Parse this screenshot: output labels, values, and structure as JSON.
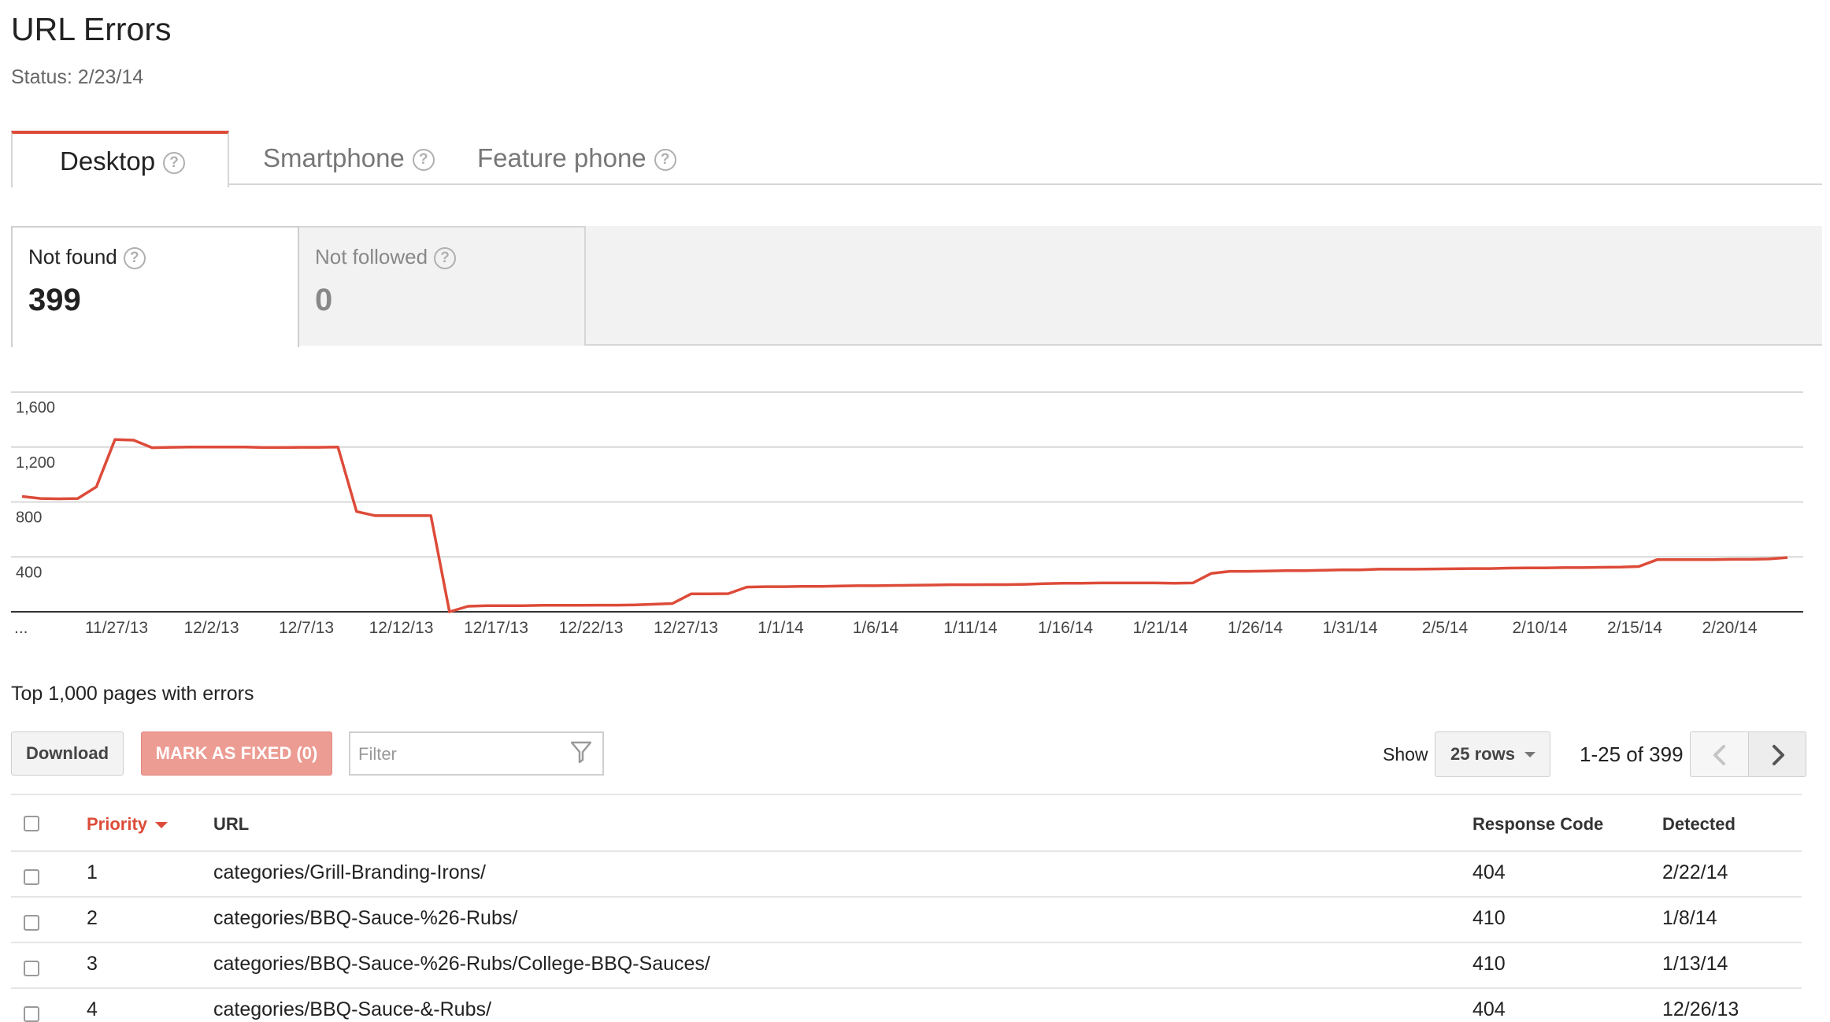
{
  "page": {
    "title": "URL Errors",
    "status": "Status: 2/23/14"
  },
  "tabs": [
    {
      "label": "Desktop",
      "active": true
    },
    {
      "label": "Smartphone",
      "active": false
    },
    {
      "label": "Feature phone",
      "active": false
    }
  ],
  "metrics": [
    {
      "label": "Not found",
      "value": "399",
      "selected": true
    },
    {
      "label": "Not followed",
      "value": "0",
      "selected": false
    }
  ],
  "icons": {
    "help": "question-mark-circle-icon",
    "filter": "filter-funnel-icon",
    "prev": "chevron-left-icon",
    "next": "chevron-right-icon"
  },
  "colors": {
    "accent": "#dd4b39",
    "line": "#dd4b39",
    "fixed_button": "#ec9c93"
  },
  "chart_data": {
    "type": "line",
    "series": [
      {
        "values": [
          840,
          825,
          823,
          825,
          910,
          1255,
          1250,
          1195,
          1198,
          1200,
          1200,
          1200,
          1200,
          1196,
          1196,
          1198,
          1198,
          1200,
          730,
          700,
          700,
          700,
          700,
          0,
          40,
          45,
          45,
          45,
          47,
          47,
          47,
          48,
          48,
          50,
          55,
          60,
          130,
          130,
          132,
          180,
          183,
          183,
          185,
          185,
          188,
          190,
          190,
          192,
          193,
          195,
          197,
          197,
          198,
          198,
          200,
          205,
          208,
          208,
          210,
          210,
          210,
          210,
          208,
          210,
          280,
          295,
          295,
          297,
          300,
          300,
          303,
          305,
          305,
          310,
          310,
          310,
          312,
          313,
          315,
          315,
          318,
          320,
          320,
          322,
          322,
          324,
          325,
          330,
          380,
          380,
          380,
          380,
          382,
          382,
          385,
          395
        ]
      }
    ],
    "x_tick_labels": [
      "...",
      "11/27/13",
      "12/2/13",
      "12/7/13",
      "12/12/13",
      "12/17/13",
      "12/22/13",
      "12/27/13",
      "1/1/14",
      "1/6/14",
      "1/11/14",
      "1/16/14",
      "1/21/14",
      "1/26/14",
      "1/31/14",
      "2/5/14",
      "2/10/14",
      "2/15/14",
      "2/20/14"
    ],
    "y_tick_labels": [
      "1,600",
      "1,200",
      "800",
      "400"
    ],
    "y_ticks": [
      1600,
      1200,
      800,
      400
    ],
    "ylim": [
      0,
      1600
    ],
    "grid": true
  },
  "table": {
    "section_title": "Top 1,000 pages with errors",
    "download_label": "Download",
    "mark_fixed_label": "MARK AS FIXED (0)",
    "filter_placeholder": "Filter",
    "show_label": "Show",
    "rows_option": "25 rows",
    "page_range": "1-25 of 399",
    "headers": {
      "priority": "Priority",
      "url": "URL",
      "response_code": "Response Code",
      "detected": "Detected"
    },
    "rows": [
      {
        "priority": "1",
        "url": "categories/Grill-Branding-Irons/",
        "response_code": "404",
        "detected": "2/22/14"
      },
      {
        "priority": "2",
        "url": "categories/BBQ-Sauce-%26-Rubs/",
        "response_code": "410",
        "detected": "1/8/14"
      },
      {
        "priority": "3",
        "url": "categories/BBQ-Sauce-%26-Rubs/College-BBQ-Sauces/",
        "response_code": "410",
        "detected": "1/13/14"
      },
      {
        "priority": "4",
        "url": "categories/BBQ-Sauce-&-Rubs/",
        "response_code": "404",
        "detected": "12/26/13"
      }
    ]
  }
}
